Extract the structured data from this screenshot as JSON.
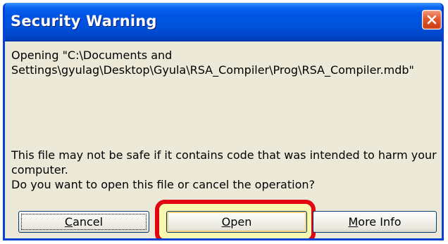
{
  "dialog": {
    "title": "Security Warning",
    "message_path_line1": "Opening \"C:\\Documents and",
    "message_path_line2": "Settings\\gyulag\\Desktop\\Gyula\\RSA_Compiler\\Prog\\RSA_Compiler.mdb\"",
    "warning_line1": "This file may not be safe if it contains code that was intended to harm your",
    "warning_line2": "computer.",
    "warning_line3": "Do you want to open this file or cancel the operation?"
  },
  "buttons": {
    "cancel": {
      "accel": "C",
      "rest": "ancel"
    },
    "open": {
      "accel": "O",
      "rest": "pen"
    },
    "more_info": {
      "accel": "M",
      "rest": "ore Info"
    }
  },
  "icons": {
    "close": "close-icon"
  },
  "colors": {
    "titlebar": "#0055e5",
    "dialog_background": "#ece9d8",
    "close_button": "#e0582e",
    "highlight_ring": "#e10610",
    "highlight_fill": "#f7f7b0"
  }
}
